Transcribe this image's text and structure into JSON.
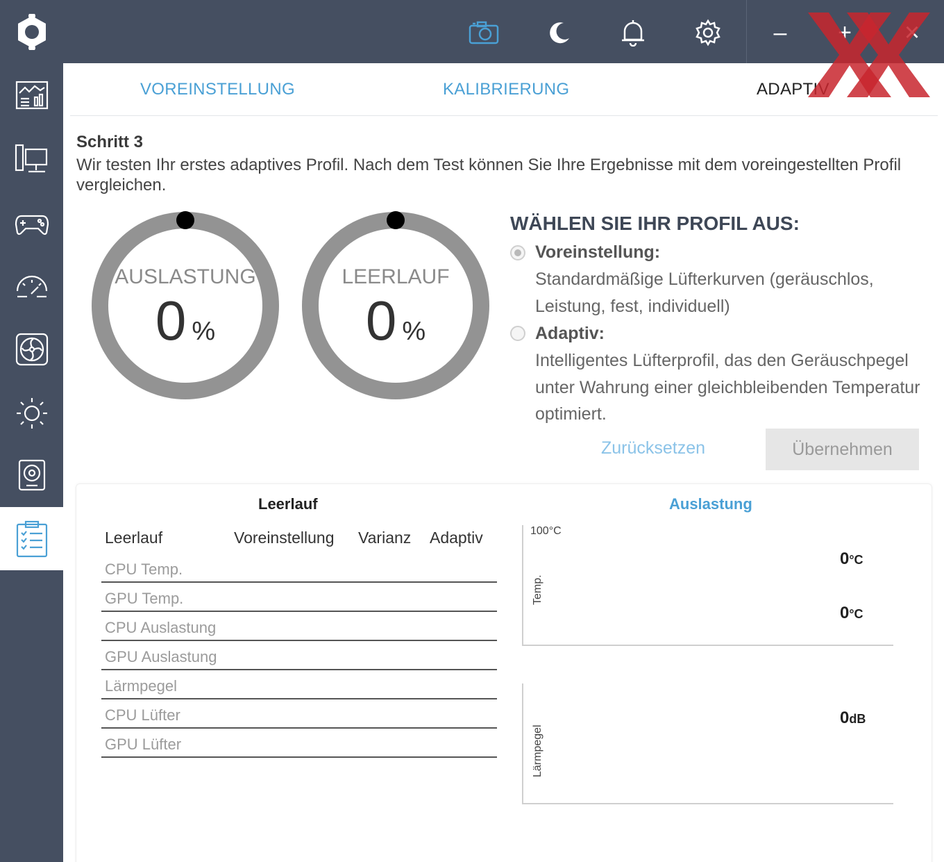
{
  "window": {
    "controls": {
      "minimize": "–",
      "maximize": "+",
      "close": "×"
    }
  },
  "colors": {
    "topbar": "#454f61",
    "accent": "#4aa0d5",
    "watermark": "#c8262e"
  },
  "tabs": [
    {
      "label": "VOREINSTELLUNG"
    },
    {
      "label": "KALIBRIERUNG"
    },
    {
      "label": "ADAPTIV"
    }
  ],
  "step": {
    "title": "Schritt 3",
    "description": "Wir testen Ihr erstes adaptives Profil. Nach dem Test können Sie Ihre Ergebnisse mit dem voreingestellten Profil vergleichen."
  },
  "gauges": [
    {
      "label": "AUSLASTUNG",
      "value": "0",
      "unit": "%"
    },
    {
      "label": "LEERLAUF",
      "value": "0",
      "unit": "%"
    }
  ],
  "profile": {
    "title": "WÄHLEN SIE IHR PROFIL AUS:",
    "options": [
      {
        "title": "Voreinstellung:",
        "description": "Standardmäßige Lüfterkurven (geräuschlos, Leistung, fest, individuell)",
        "selected": true
      },
      {
        "title": "Adaptiv:",
        "description": "Intelligentes Lüfterprofil, das den Geräuschpegel unter Wahrung einer gleichbleibenden Temperatur optimiert.",
        "selected": false
      }
    ],
    "reset_label": "Zurücksetzen",
    "apply_label": "Übernehmen"
  },
  "results": {
    "left_title": "Leerlauf",
    "right_title": "Auslastung",
    "table": {
      "headers": [
        "Leerlauf",
        "Voreinstellung",
        "Varianz",
        "Adaptiv"
      ],
      "rows": [
        "CPU Temp.",
        "GPU Temp.",
        "CPU Auslastung",
        "GPU Auslastung",
        "Lärmpegel",
        "CPU Lüfter",
        "GPU Lüfter"
      ]
    },
    "temp_chart": {
      "axis_label": "Temp.",
      "max_label": "100°C",
      "readouts": [
        {
          "value": "0",
          "unit": "°C"
        },
        {
          "value": "0",
          "unit": "°C"
        }
      ]
    },
    "noise_chart": {
      "axis_label": "Lärmpegel",
      "readouts": [
        {
          "value": "0",
          "unit": "dB"
        }
      ]
    }
  },
  "watermark": {
    "text": "XX"
  }
}
